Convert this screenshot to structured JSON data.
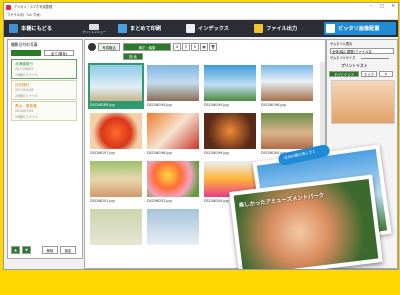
{
  "window": {
    "title": "デジカメ・スマホ写真整理"
  },
  "menu": {
    "file": "ファイル(F)",
    "help": "ヘルプ(H)"
  },
  "toolbar": {
    "home": "本棚にもどる",
    "print_menu": "プリントメニュー",
    "batch_print": "まとめて印刷",
    "index": "インデックス",
    "file_output": "ファイル出力",
    "fit_layout": "ピッタリ画像配置"
  },
  "left": {
    "header": "撮影日付の写真",
    "filter_label": "全て(単年)",
    "folders": [
      {
        "title": "北海道旅行",
        "date": "2017/06/05",
        "count": "14個のファイル"
      },
      {
        "title": "日光旅行",
        "date": "2017/04/16",
        "count": "20個のファイル"
      },
      {
        "title": "青山・表参道",
        "date": "2015/07/02",
        "count": "20個のファイル"
      }
    ],
    "delete": "削除",
    "settings": "設定"
  },
  "mid": {
    "import": "写真取込",
    "edit": "補正・編集",
    "search": "検 索",
    "photos": [
      {
        "name": "DSCN6189.jpg",
        "selected": true
      },
      {
        "name": "DSCN6194.jpg"
      },
      {
        "name": "DSCN6195.jpg"
      },
      {
        "name": "DSCN6196.jpg"
      },
      {
        "name": "DSCN6197.jpg"
      },
      {
        "name": "DSCN6198.jpg"
      },
      {
        "name": "DSCN6199.jpg"
      },
      {
        "name": "DSCN6200.jpg"
      },
      {
        "name": "DSCN6201.jpg"
      },
      {
        "name": "DSCN6202.jpg"
      },
      {
        "name": "DSCN6204.jpg"
      },
      {
        "name": ""
      }
    ]
  },
  "right": {
    "thumb_display": "サムネイル表示",
    "thumb_select": "全体(幅に調整)ファイル名",
    "thumb_size": "サムネイルサイズ",
    "print_list": "プリントリスト",
    "add_all": "すべてクリア",
    "clear": "クリア"
  },
  "overlay": {
    "caption_top": "日光の朝の清しさと",
    "caption_main": "楽しかったアミューズメントパーク"
  },
  "colors": {
    "accent": "#1f8ad6",
    "toolbar": "#2b2f35",
    "frame": "#ffd800"
  }
}
